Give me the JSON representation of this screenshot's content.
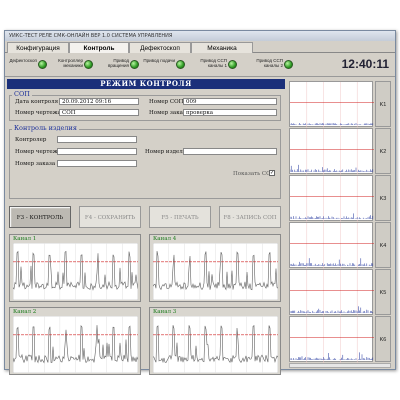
{
  "window": {
    "title": "УИКС-ТЕСТ РЕЛЕ СМК-ОНЛАЙН ВЕР 1.0 СИСТЕМА УПРАВЛЕНИЯ"
  },
  "tabs": [
    {
      "label": "Конфигурация",
      "active": false
    },
    {
      "label": "Контроль",
      "active": true
    },
    {
      "label": "Дефектоскоп",
      "active": false
    },
    {
      "label": "Механика",
      "active": false
    }
  ],
  "indicators": [
    {
      "label": "Дефектоскоп"
    },
    {
      "label": "Контроллер механики"
    },
    {
      "label": "Привод вращения"
    },
    {
      "label": "Привод подачи"
    },
    {
      "label": "Привод ССП каналы 1"
    },
    {
      "label": "Привод ССП каналы 2"
    }
  ],
  "clock": "12:40:11",
  "mode_title": "РЕЖИМ КОНТРОЛЯ",
  "sop": {
    "group_title": "СОП",
    "date_label": "Дата контроля",
    "date_value": "20.09.2012  09:16",
    "sop_num_label": "Номер СОП",
    "sop_num_value": "009",
    "drawing_label": "Номер чертежа",
    "drawing_value": "СОП",
    "order_label": "Номер заказа",
    "order_value": "проверка"
  },
  "item": {
    "group_title": "Контроль изделия",
    "controller_label": "Контролер",
    "controller_value": "",
    "drawing_label": "Номер чертежа",
    "drawing_value": "",
    "item_num_label": "Номер изделия",
    "item_num_value": "",
    "order_label": "Номер заказа",
    "order_value": "",
    "show_sop_label": "Показать СОП",
    "show_sop_checked": true
  },
  "buttons": {
    "f3": "F3 - КОНТРОЛЬ",
    "f4": "F4 - СОХРАНИТЬ",
    "f5": "F5 - ПЕЧАТЬ",
    "f8": "F8 - ЗАПИСЬ СОП"
  },
  "channels": [
    {
      "label": "Канал 1"
    },
    {
      "label": "Канал 4"
    },
    {
      "label": "Канал 2"
    },
    {
      "label": "Канал 3"
    }
  ],
  "strip_labels": [
    "K1",
    "K2",
    "K3",
    "K4",
    "K5",
    "K6"
  ],
  "colors": {
    "accent": "#1b2f7a",
    "led": "#2f9c24",
    "threshold": "#d02020",
    "signal": "#606060"
  }
}
